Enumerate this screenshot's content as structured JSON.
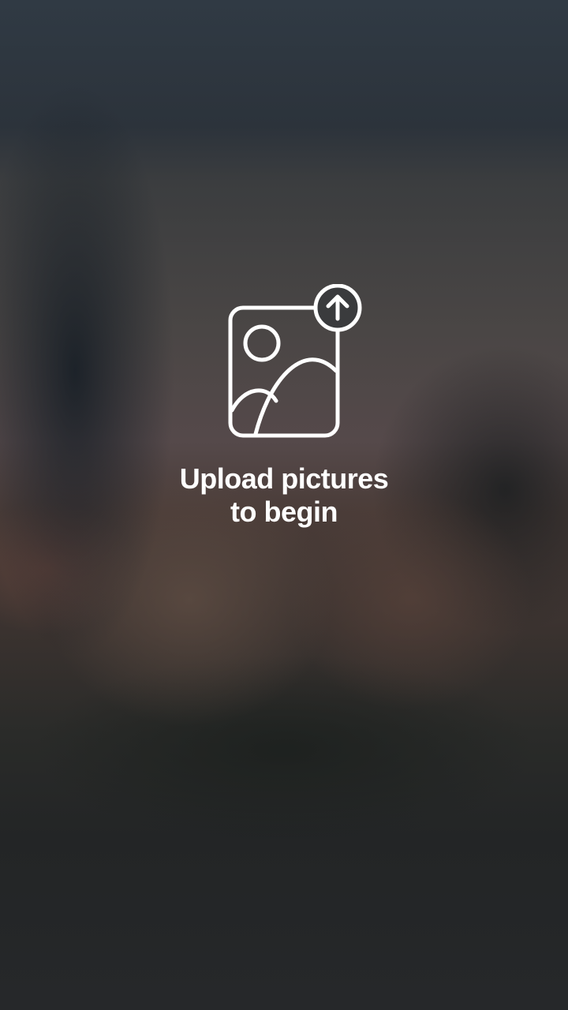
{
  "upload_prompt": {
    "line1": "Upload pictures",
    "line2": "to begin"
  },
  "icons": {
    "main": "image-upload-icon"
  },
  "colors": {
    "text": "#ffffff",
    "icon_stroke": "#ffffff"
  }
}
